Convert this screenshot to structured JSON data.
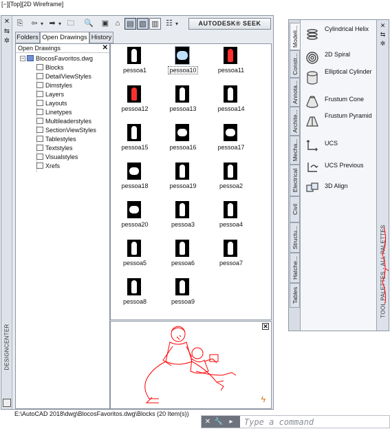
{
  "viewport_label": "[−][Top][2D Wireframe]",
  "design_center": {
    "vertical_title": "DESIGNCENTER",
    "toolbar": {
      "seek_label": "AUTODESK® SEEK"
    },
    "tabs": [
      {
        "label": "Folders"
      },
      {
        "label": "Open Drawings"
      },
      {
        "label": "History"
      }
    ],
    "tree": {
      "header": "Open Drawings",
      "root": "BlocosFavoritos.dwg",
      "items": [
        {
          "label": "Blocks"
        },
        {
          "label": "DetailViewStyles"
        },
        {
          "label": "Dimstyles"
        },
        {
          "label": "Layers"
        },
        {
          "label": "Layouts"
        },
        {
          "label": "Linetypes"
        },
        {
          "label": "Multileaderstyles"
        },
        {
          "label": "SectionViewStyles"
        },
        {
          "label": "Tablestyles"
        },
        {
          "label": "Textstyles"
        },
        {
          "label": "Visualstyles"
        },
        {
          "label": "Xrefs"
        }
      ]
    },
    "blocks": [
      {
        "label": "pessoa1"
      },
      {
        "label": "pessoa10"
      },
      {
        "label": "pessoa11"
      },
      {
        "label": "pessoa12"
      },
      {
        "label": "pessoa13"
      },
      {
        "label": "pessoa14"
      },
      {
        "label": "pessoa15"
      },
      {
        "label": "pessoa16"
      },
      {
        "label": "pessoa17"
      },
      {
        "label": "pessoa18"
      },
      {
        "label": "pessoa19"
      },
      {
        "label": "pessoa2"
      },
      {
        "label": "pessoa20"
      },
      {
        "label": "pessoa3"
      },
      {
        "label": "pessoa4"
      },
      {
        "label": "pessoa5"
      },
      {
        "label": "pessoa6"
      },
      {
        "label": "pessoa7"
      },
      {
        "label": "pessoa8"
      },
      {
        "label": "pessoa9"
      }
    ],
    "status": "E:\\AutoCAD 2018\\dwg\\BlocosFavoritos.dwg\\Blocks (20 Item(s))"
  },
  "tool_palettes": {
    "vertical_title": "TOOL PALETTES - ALL PALETTES",
    "tabs": [
      {
        "label": "Modeli..."
      },
      {
        "label": "Constr..."
      },
      {
        "label": "Annota..."
      },
      {
        "label": "Archite..."
      },
      {
        "label": "Mecha..."
      },
      {
        "label": "Electrical"
      },
      {
        "label": "Civil"
      },
      {
        "label": "Structu..."
      },
      {
        "label": "Hatche..."
      },
      {
        "label": "Tables"
      }
    ],
    "tools": [
      {
        "label": "Cylindrical Helix",
        "icon": "helix-icon"
      },
      {
        "label": "2D Spiral",
        "icon": "spiral-icon"
      },
      {
        "label": "Elliptical Cylinder",
        "icon": "cylinder-icon"
      },
      {
        "label": "Frustum Cone",
        "icon": "cone-icon"
      },
      {
        "label": "Frustum Pyramid",
        "icon": "pyramid-icon"
      },
      {
        "label": "UCS",
        "icon": "ucs-icon"
      },
      {
        "label": "UCS Previous",
        "icon": "ucs-previous-icon"
      },
      {
        "label": "3D Align",
        "icon": "align-icon"
      }
    ]
  },
  "command_line": {
    "placeholder": "Type a command"
  },
  "colors": {
    "preview_drawing": "#ff0000",
    "palette_background": "#f4f6f9",
    "command_buttons": "#6d737c"
  }
}
